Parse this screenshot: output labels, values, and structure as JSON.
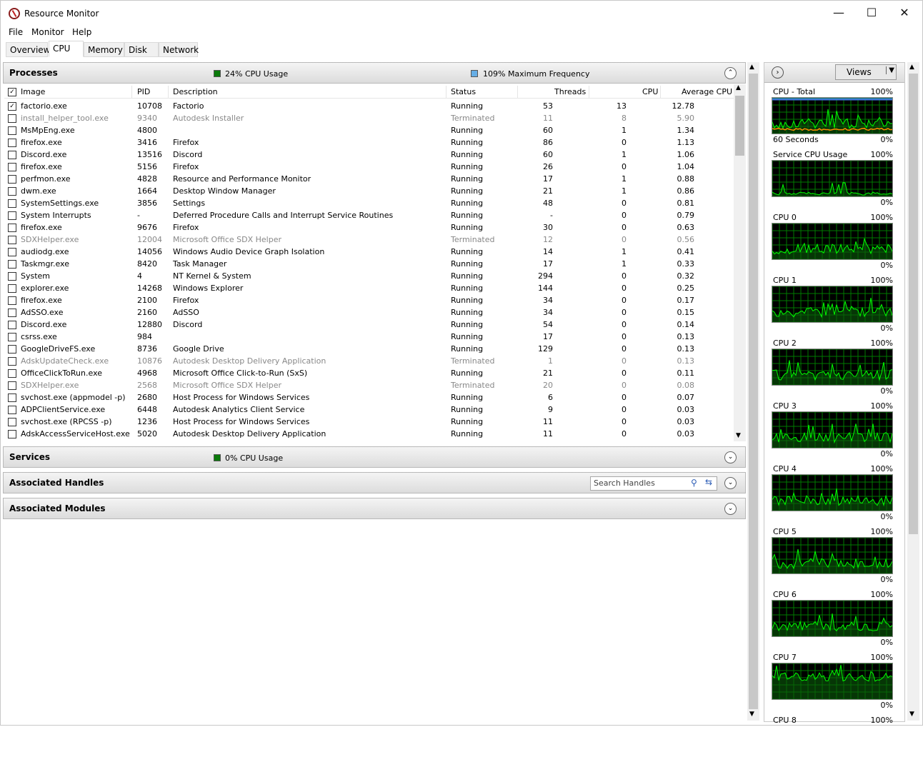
{
  "title": "Resource Monitor",
  "menu": [
    "File",
    "Monitor",
    "Help"
  ],
  "tabs": [
    "Overview",
    "CPU",
    "Memory",
    "Disk",
    "Network"
  ],
  "processes": {
    "title": "Processes",
    "cpu_usage": "24% CPU Usage",
    "max_freq": "109% Maximum Frequency",
    "columns": [
      "Image",
      "PID",
      "Description",
      "Status",
      "Threads",
      "CPU",
      "Average CPU"
    ],
    "rows": [
      [
        "factorio.exe",
        "10708",
        "Factorio",
        "Running",
        "53",
        "13",
        "12.78"
      ],
      [
        "install_helper_tool.exe",
        "9340",
        "Autodesk Installer",
        "Terminated",
        "11",
        "8",
        "5.90"
      ],
      [
        "MsMpEng.exe",
        "4800",
        "",
        "Running",
        "60",
        "1",
        "1.34"
      ],
      [
        "firefox.exe",
        "3416",
        "Firefox",
        "Running",
        "86",
        "0",
        "1.13"
      ],
      [
        "Discord.exe",
        "13516",
        "Discord",
        "Running",
        "60",
        "1",
        "1.06"
      ],
      [
        "firefox.exe",
        "5156",
        "Firefox",
        "Running",
        "26",
        "0",
        "1.04"
      ],
      [
        "perfmon.exe",
        "4828",
        "Resource and Performance Monitor",
        "Running",
        "17",
        "1",
        "0.88"
      ],
      [
        "dwm.exe",
        "1664",
        "Desktop Window Manager",
        "Running",
        "21",
        "1",
        "0.86"
      ],
      [
        "SystemSettings.exe",
        "3856",
        "Settings",
        "Running",
        "48",
        "0",
        "0.81"
      ],
      [
        "System Interrupts",
        "-",
        "Deferred Procedure Calls and Interrupt Service Routines",
        "Running",
        "-",
        "0",
        "0.79"
      ],
      [
        "firefox.exe",
        "9676",
        "Firefox",
        "Running",
        "30",
        "0",
        "0.63"
      ],
      [
        "SDXHelper.exe",
        "12004",
        "Microsoft Office SDX Helper",
        "Terminated",
        "12",
        "0",
        "0.56"
      ],
      [
        "audiodg.exe",
        "14056",
        "Windows Audio Device Graph Isolation",
        "Running",
        "14",
        "1",
        "0.41"
      ],
      [
        "Taskmgr.exe",
        "8420",
        "Task Manager",
        "Running",
        "17",
        "1",
        "0.33"
      ],
      [
        "System",
        "4",
        "NT Kernel & System",
        "Running",
        "294",
        "0",
        "0.32"
      ],
      [
        "explorer.exe",
        "14268",
        "Windows Explorer",
        "Running",
        "144",
        "0",
        "0.25"
      ],
      [
        "firefox.exe",
        "2100",
        "Firefox",
        "Running",
        "34",
        "0",
        "0.17"
      ],
      [
        "AdSSO.exe",
        "2160",
        "AdSSO",
        "Running",
        "34",
        "0",
        "0.15"
      ],
      [
        "Discord.exe",
        "12880",
        "Discord",
        "Running",
        "54",
        "0",
        "0.14"
      ],
      [
        "csrss.exe",
        "984",
        "",
        "Running",
        "17",
        "0",
        "0.13"
      ],
      [
        "GoogleDriveFS.exe",
        "8736",
        "Google Drive",
        "Running",
        "129",
        "0",
        "0.13"
      ],
      [
        "AdskUpdateCheck.exe",
        "10876",
        "Autodesk Desktop Delivery Application",
        "Terminated",
        "1",
        "0",
        "0.13"
      ],
      [
        "OfficeClickToRun.exe",
        "4968",
        "Microsoft Office Click-to-Run (SxS)",
        "Running",
        "21",
        "0",
        "0.11"
      ],
      [
        "SDXHelper.exe",
        "2568",
        "Microsoft Office SDX Helper",
        "Terminated",
        "20",
        "0",
        "0.08"
      ],
      [
        "svchost.exe (appmodel -p)",
        "2680",
        "Host Process for Windows Services",
        "Running",
        "6",
        "0",
        "0.07"
      ],
      [
        "ADPClientService.exe",
        "6448",
        "Autodesk Analytics Client Service",
        "Running",
        "9",
        "0",
        "0.03"
      ],
      [
        "svchost.exe (RPCSS -p)",
        "1236",
        "Host Process for Windows Services",
        "Running",
        "11",
        "0",
        "0.03"
      ],
      [
        "AdskAccessServiceHost.exe",
        "5020",
        "Autodesk Desktop Delivery Application",
        "Running",
        "11",
        "0",
        "0.03"
      ]
    ],
    "checked": [
      true
    ]
  },
  "services": {
    "title": "Services",
    "cpu_usage": "0% CPU Usage"
  },
  "handles": {
    "title": "Associated Handles",
    "search_placeholder": "Search Handles"
  },
  "modules": {
    "title": "Associated Modules"
  },
  "side": {
    "views_label": "Views",
    "graphs": [
      {
        "label": "CPU - Total",
        "max": "100%",
        "min": "0%",
        "sub": "60 Seconds"
      },
      {
        "label": "Service CPU Usage",
        "max": "100%",
        "min": "0%"
      },
      {
        "label": "CPU 0",
        "max": "100%",
        "min": "0%"
      },
      {
        "label": "CPU 1",
        "max": "100%",
        "min": "0%"
      },
      {
        "label": "CPU 2",
        "max": "100%",
        "min": "0%"
      },
      {
        "label": "CPU 3",
        "max": "100%",
        "min": "0%"
      },
      {
        "label": "CPU 4",
        "max": "100%",
        "min": "0%"
      },
      {
        "label": "CPU 5",
        "max": "100%",
        "min": "0%"
      },
      {
        "label": "CPU 6",
        "max": "100%",
        "min": "0%"
      },
      {
        "label": "CPU 7",
        "max": "100%",
        "min": "0%"
      },
      {
        "label": "CPU 8",
        "max": "100%"
      }
    ]
  },
  "colors": {
    "graph_line": "#00ff00",
    "graph_bg": "#000000",
    "grid": "#007a00",
    "total_line": "#ff8c00",
    "max_freq": "#3c78d8"
  }
}
